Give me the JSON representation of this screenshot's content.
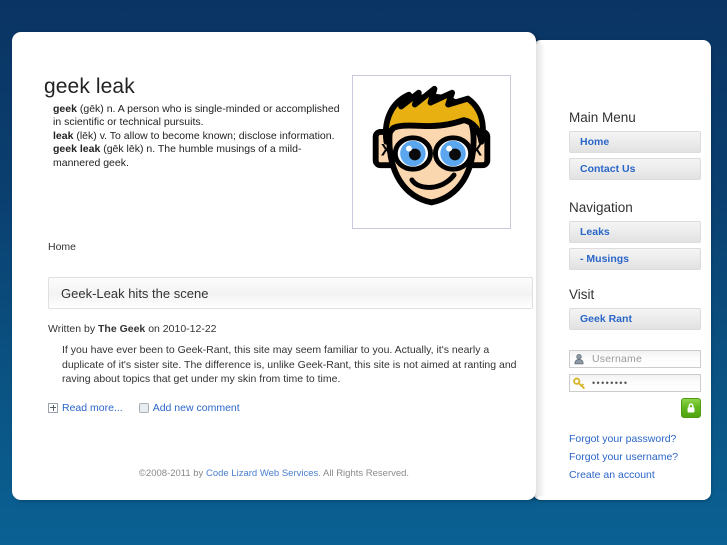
{
  "site": {
    "title": "geek leak",
    "definitions": [
      {
        "term": "geek",
        "rest": " (gēk) n. A person who is single-minded or accomplished in scientific or technical pursuits."
      },
      {
        "term": "leak",
        "rest": " (lēk) v. To allow to become known; disclose information."
      },
      {
        "term": "geek leak",
        "rest": " (gēk lēk) n. The humble musings of a mild-mannered geek."
      }
    ],
    "logo_alt": "geek-head-logo"
  },
  "breadcrumb": "Home",
  "article": {
    "title": "Geek-Leak hits the scene",
    "meta_prefix": "Written by ",
    "author": "The Geek",
    "meta_suffix": " on 2010-12-22",
    "body": "If you have ever been to Geek-Rant, this site may seem familiar to you.  Actually, it's nearly a duplicate of it's sister site.  The difference is, unlike Geek-Rant, this site is not aimed at ranting and raving about topics that get under my skin from time to time.",
    "read_more": "Read more...",
    "add_comment": "Add new comment"
  },
  "sidebar": {
    "main_menu": {
      "title": "Main Menu",
      "items": [
        {
          "label": "Home"
        },
        {
          "label": "Contact Us"
        }
      ]
    },
    "navigation": {
      "title": "Navigation",
      "items": [
        {
          "label": "Leaks"
        },
        {
          "label": "- Musings"
        }
      ]
    },
    "visit": {
      "title": "Visit",
      "items": [
        {
          "label": "Geek Rant"
        }
      ]
    },
    "login": {
      "username_placeholder": "Username",
      "password_value": "••••••••",
      "submit_label": "lock-login",
      "links": [
        {
          "label": "Forgot your password?"
        },
        {
          "label": "Forgot your username?"
        },
        {
          "label": "Create an account"
        }
      ]
    }
  },
  "footer": {
    "prefix": "©2008-2011 by ",
    "link": "Code Lizard Web Services",
    "suffix": ". All Rights Reserved."
  },
  "colors": {
    "bg_top": "#0a3463",
    "bg_bottom": "#0a6193",
    "link": "#2a66c8",
    "login_green": "#63b81f",
    "hair": "#e8b010",
    "skin": "#fbd7b0",
    "eye": "#5aa7f0"
  }
}
